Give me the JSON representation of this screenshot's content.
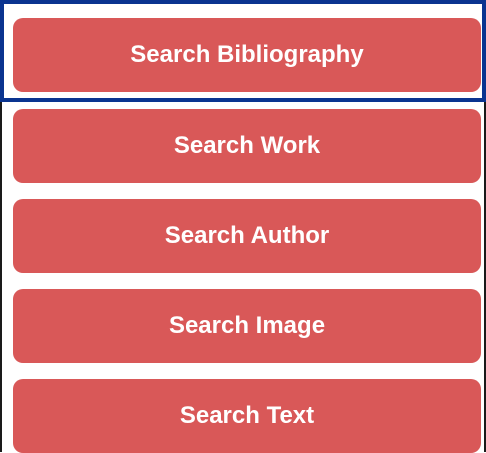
{
  "colors": {
    "button_bg": "#d95858",
    "button_text": "#ffffff",
    "focus_border": "#0a3490"
  },
  "buttons": [
    {
      "label": "Search Bibliography",
      "focused": true
    },
    {
      "label": "Search Work",
      "focused": false
    },
    {
      "label": "Search Author",
      "focused": false
    },
    {
      "label": "Search Image",
      "focused": false
    },
    {
      "label": "Search Text",
      "focused": false
    }
  ]
}
